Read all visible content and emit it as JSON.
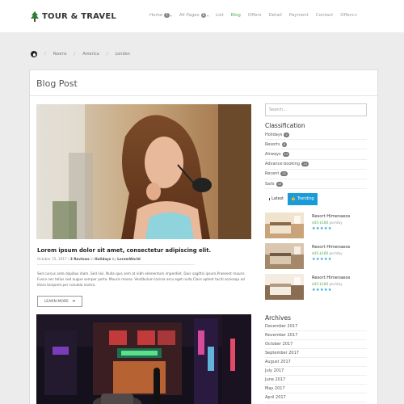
{
  "header": {
    "logo_text": "TOUR & TRAVEL",
    "nav": [
      {
        "label": "Home",
        "badge": "7",
        "caret": true,
        "active": false
      },
      {
        "label": "All Pages",
        "badge": "6",
        "caret": true,
        "active": false
      },
      {
        "label": "List",
        "badge": "",
        "caret": false,
        "active": false
      },
      {
        "label": "Blog",
        "badge": "",
        "caret": false,
        "active": true
      },
      {
        "label": "Offers",
        "badge": "",
        "caret": false,
        "active": false
      },
      {
        "label": "Detail",
        "badge": "",
        "caret": false,
        "active": false
      },
      {
        "label": "Payment",
        "badge": "",
        "caret": false,
        "active": false
      },
      {
        "label": "Contact",
        "badge": "",
        "caret": false,
        "active": false
      },
      {
        "label": "Offers+",
        "badge": "",
        "caret": false,
        "active": false
      }
    ]
  },
  "breadcrumb": [
    "Rooms",
    "America",
    "London"
  ],
  "page_title": "Blog Post",
  "post": {
    "title": "Lorem ipsum dolor sit amet, consectetur adipiscing elit.",
    "date": "October 15, 2017",
    "reviews": "3 Reviews",
    "in_text": " in ",
    "category": "Holidays",
    "by_text": " by ",
    "author": "LoremWorld",
    "excerpt": "Sed cursus ante dapibus diam. Sed nisi. Nulla quis sem at nibh elementum imperdiet. Duis sagittis ipsum.Praesent mauris. Fusce nec tellus sed augue semper porta. Mauris massa. Vestibulum lacinia arcu eget nulla.Class aptent taciti sociosqu ad litora torquent per conubia nostra.",
    "button": "LEARN MORE"
  },
  "sidebar": {
    "search_placeholder": "Search...",
    "classification_title": "Classification",
    "classification": [
      {
        "label": "Holidays",
        "count": "4"
      },
      {
        "label": "Resorts",
        "count": "8"
      },
      {
        "label": "Airways",
        "count": "15"
      },
      {
        "label": "Advance booking",
        "count": "14"
      },
      {
        "label": "Recent",
        "count": "22"
      },
      {
        "label": "Sails",
        "count": "43"
      }
    ],
    "tabs": {
      "latest": "Latest",
      "trending": "Trending"
    },
    "related": [
      {
        "name": "Resort Himenaeos",
        "price": "$45-$180",
        "unit": " per/day",
        "stars": "★★★★★"
      },
      {
        "name": "Resort Himenaeos",
        "price": "$45-$180",
        "unit": " per/day",
        "stars": "★★★★★"
      },
      {
        "name": "Resort Himenaeos",
        "price": "$45-$180",
        "unit": " per/day",
        "stars": "★★★★★"
      }
    ],
    "archives_title": "Archives",
    "archives": [
      "December 2017",
      "November 2017",
      "October 2017",
      "September 2017",
      "August 2017",
      "July 2017",
      "June 2017",
      "May 2017",
      "April 2017"
    ]
  },
  "colors": {
    "accent_green": "#4caf50",
    "accent_blue": "#1a9bd7"
  },
  "icons": {
    "logo": "tree-icon",
    "home": "home-icon",
    "button_arrow": "arrow-right-icon"
  }
}
